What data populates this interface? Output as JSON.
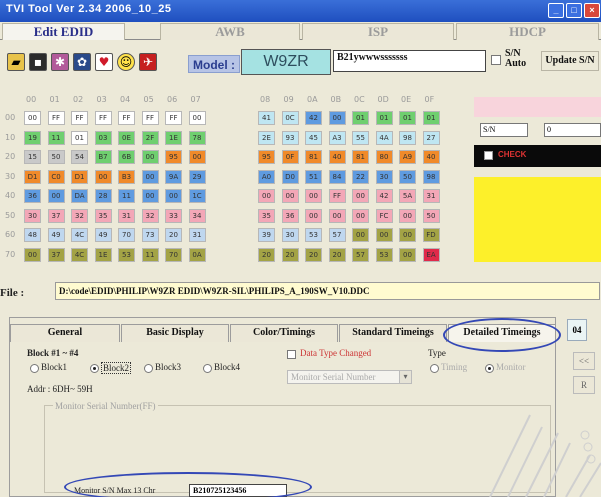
{
  "window": {
    "title": "TVI Tool Ver 2.34 2006_10_25"
  },
  "main_tabs": [
    {
      "label": "Edit EDID"
    },
    {
      "label": "AWB"
    },
    {
      "label": "ISP"
    },
    {
      "label": "HDCP"
    }
  ],
  "toolbar": {
    "icons": [
      "open-folder-icon",
      "save-icon",
      "star-icon",
      "gear-icon",
      "heart-icon",
      "smiley-icon",
      "bird-icon"
    ],
    "model_label": "Model :",
    "model_value": "W9ZR",
    "serial_value": "B21ywwwsssssss",
    "sn_auto_label_1": "S/N",
    "sn_auto_label_2": "Auto",
    "update_label": "Update S/N"
  },
  "hex": {
    "columns": [
      "00",
      "01",
      "02",
      "03",
      "04",
      "05",
      "06",
      "07",
      "",
      "08",
      "09",
      "0A",
      "0B",
      "0C",
      "0D",
      "0E",
      "0F"
    ],
    "row_headers": [
      "00",
      "10",
      "20",
      "30",
      "40",
      "50",
      "60",
      "70"
    ],
    "rows": [
      [
        [
          "00",
          "#ffffff"
        ],
        [
          "FF",
          "#ffffff"
        ],
        [
          "FF",
          "#ffffff"
        ],
        [
          "FF",
          "#ffffff"
        ],
        [
          "FF",
          "#ffffff"
        ],
        [
          "FF",
          "#ffffff"
        ],
        [
          "FF",
          "#ffffff"
        ],
        [
          "00",
          "#ffffff"
        ],
        [
          "41",
          "#bfe6f2"
        ],
        [
          "0C",
          "#bfe6f2"
        ],
        [
          "42",
          "#5f9be0"
        ],
        [
          "00",
          "#5f9be0"
        ],
        [
          "01",
          "#6fcf6f"
        ],
        [
          "01",
          "#6fcf6f"
        ],
        [
          "01",
          "#6fcf6f"
        ],
        [
          "01",
          "#6fcf6f"
        ]
      ],
      [
        [
          "19",
          "#6fcf6f"
        ],
        [
          "11",
          "#6fcf6f"
        ],
        [
          "01",
          "#ffffff"
        ],
        [
          "03",
          "#6fcf6f"
        ],
        [
          "0E",
          "#6fcf6f"
        ],
        [
          "2F",
          "#6fcf6f"
        ],
        [
          "1E",
          "#6fcf6f"
        ],
        [
          "78",
          "#6fcf6f"
        ],
        [
          "2E",
          "#bfe6f2"
        ],
        [
          "93",
          "#bfe6f2"
        ],
        [
          "45",
          "#bfe6f2"
        ],
        [
          "A3",
          "#bfe6f2"
        ],
        [
          "55",
          "#bfe6f2"
        ],
        [
          "4A",
          "#bfe6f2"
        ],
        [
          "98",
          "#bfe6f2"
        ],
        [
          "27",
          "#bfe6f2"
        ]
      ],
      [
        [
          "15",
          "#c9c9c9"
        ],
        [
          "50",
          "#c9c9c9"
        ],
        [
          "54",
          "#c9c9c9"
        ],
        [
          "B7",
          "#6fcf6f"
        ],
        [
          "6B",
          "#6fcf6f"
        ],
        [
          "00",
          "#6fcf6f"
        ],
        [
          "95",
          "#f08a2a"
        ],
        [
          "00",
          "#f08a2a"
        ],
        [
          "95",
          "#f08a2a"
        ],
        [
          "0F",
          "#f08a2a"
        ],
        [
          "81",
          "#f08a2a"
        ],
        [
          "40",
          "#f08a2a"
        ],
        [
          "81",
          "#f08a2a"
        ],
        [
          "80",
          "#f08a2a"
        ],
        [
          "A9",
          "#f08a2a"
        ],
        [
          "40",
          "#f08a2a"
        ]
      ],
      [
        [
          "D1",
          "#f08a2a"
        ],
        [
          "C0",
          "#f08a2a"
        ],
        [
          "D1",
          "#f08a2a"
        ],
        [
          "00",
          "#f08a2a"
        ],
        [
          "B3",
          "#f08a2a"
        ],
        [
          "00",
          "#5f9be0"
        ],
        [
          "9A",
          "#5f9be0"
        ],
        [
          "29",
          "#5f9be0"
        ],
        [
          "A0",
          "#5f9be0"
        ],
        [
          "D0",
          "#5f9be0"
        ],
        [
          "51",
          "#5f9be0"
        ],
        [
          "84",
          "#5f9be0"
        ],
        [
          "22",
          "#5f9be0"
        ],
        [
          "30",
          "#5f9be0"
        ],
        [
          "50",
          "#5f9be0"
        ],
        [
          "98",
          "#5f9be0"
        ]
      ],
      [
        [
          "36",
          "#5f9be0"
        ],
        [
          "00",
          "#5f9be0"
        ],
        [
          "DA",
          "#5f9be0"
        ],
        [
          "28",
          "#5f9be0"
        ],
        [
          "11",
          "#5f9be0"
        ],
        [
          "00",
          "#5f9be0"
        ],
        [
          "00",
          "#5f9be0"
        ],
        [
          "1C",
          "#5f9be0"
        ],
        [
          "00",
          "#f3a7b7"
        ],
        [
          "00",
          "#f3a7b7"
        ],
        [
          "00",
          "#f3a7b7"
        ],
        [
          "FF",
          "#f3a7b7"
        ],
        [
          "00",
          "#f3a7b7"
        ],
        [
          "42",
          "#f3a7b7"
        ],
        [
          "5A",
          "#f3a7b7"
        ],
        [
          "31",
          "#f3a7b7"
        ]
      ],
      [
        [
          "30",
          "#f3a7b7"
        ],
        [
          "37",
          "#f3a7b7"
        ],
        [
          "32",
          "#f3a7b7"
        ],
        [
          "35",
          "#f3a7b7"
        ],
        [
          "31",
          "#f3a7b7"
        ],
        [
          "32",
          "#f3a7b7"
        ],
        [
          "33",
          "#f3a7b7"
        ],
        [
          "34",
          "#f3a7b7"
        ],
        [
          "35",
          "#f3a7b7"
        ],
        [
          "36",
          "#f3a7b7"
        ],
        [
          "00",
          "#f3a7b7"
        ],
        [
          "00",
          "#f3a7b7"
        ],
        [
          "00",
          "#f3a7b7"
        ],
        [
          "FC",
          "#f3a7b7"
        ],
        [
          "00",
          "#f3a7b7"
        ],
        [
          "50",
          "#f3a7b7"
        ]
      ],
      [
        [
          "48",
          "#bfd7ef"
        ],
        [
          "49",
          "#bfd7ef"
        ],
        [
          "4C",
          "#bfd7ef"
        ],
        [
          "49",
          "#bfd7ef"
        ],
        [
          "70",
          "#bfd7ef"
        ],
        [
          "73",
          "#bfd7ef"
        ],
        [
          "20",
          "#bfd7ef"
        ],
        [
          "31",
          "#bfd7ef"
        ],
        [
          "39",
          "#bfd7ef"
        ],
        [
          "30",
          "#bfd7ef"
        ],
        [
          "53",
          "#bfd7ef"
        ],
        [
          "57",
          "#bfd7ef"
        ],
        [
          "00",
          "#a3a345"
        ],
        [
          "00",
          "#a3a345"
        ],
        [
          "00",
          "#a3a345"
        ],
        [
          "FD",
          "#a3a345"
        ]
      ],
      [
        [
          "00",
          "#a3a345"
        ],
        [
          "37",
          "#a3a345"
        ],
        [
          "4C",
          "#a3a345"
        ],
        [
          "1E",
          "#a3a345"
        ],
        [
          "53",
          "#a3a345"
        ],
        [
          "11",
          "#a3a345"
        ],
        [
          "70",
          "#a3a345"
        ],
        [
          "0A",
          "#a3a345"
        ],
        [
          "20",
          "#a3a345"
        ],
        [
          "20",
          "#a3a345"
        ],
        [
          "20",
          "#a3a345"
        ],
        [
          "20",
          "#a3a345"
        ],
        [
          "57",
          "#a3a345"
        ],
        [
          "53",
          "#a3a345"
        ],
        [
          "00",
          "#a3a345"
        ],
        [
          "EA",
          "#e02a4a"
        ]
      ]
    ]
  },
  "side": {
    "sn_label": "S/N",
    "sn_value": "0",
    "black_label": "CHECK"
  },
  "file": {
    "label": "File :",
    "path": "D:\\code\\EDID\\PHILIP\\W9ZR EDID\\W9ZR-SIL\\PHILIPS_A_190SW_V10.DDC"
  },
  "sub_tabs": [
    {
      "label": "General"
    },
    {
      "label": "Basic Display"
    },
    {
      "label": "Color/Timings"
    },
    {
      "label": "Standard Timeings"
    },
    {
      "label": "Detailed Timeings"
    }
  ],
  "right_panel": {
    "number": "04",
    "btn_1": "<<",
    "btn_2": "R"
  },
  "detail": {
    "block_group_label": "Block #1 ~ #4",
    "blocks": [
      "Block1",
      "Block2",
      "Block3",
      "Block4"
    ],
    "addr": "Addr : 6DH~ 59H",
    "data_type_changed": "Data Type Changed",
    "type_label": "Type",
    "type_options": [
      "Timing",
      "Monitor"
    ],
    "select_value": "Monitor Serial Number",
    "group_caption": "Monitor Serial Number(FF)",
    "monitor_label": "Monitor S/N Max 13 Chr",
    "monitor_value": "B210725123456"
  }
}
